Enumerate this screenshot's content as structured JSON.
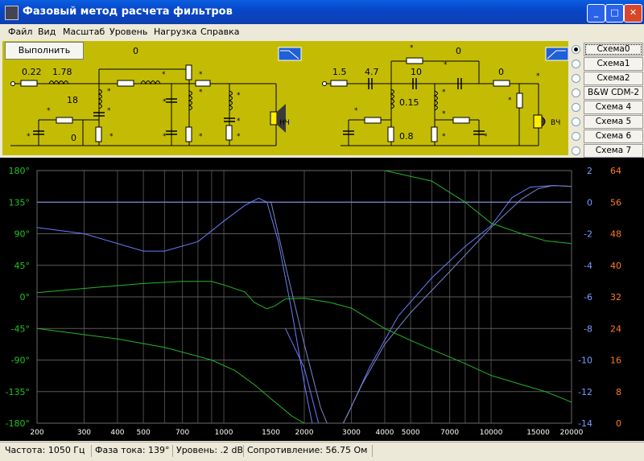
{
  "window": {
    "title": "Фазовый метод расчета фильтров"
  },
  "menu": [
    "Файл",
    "Вид",
    "Масштаб",
    "Уровень",
    "Нагрузка",
    "Справка"
  ],
  "run_label": "Выполнить",
  "schemes": {
    "items": [
      "Схема0",
      "Схема1",
      "Схема2",
      "B&W CDM-2",
      "Схема 4",
      "Схема 5",
      "Схема 6",
      "Схема 7"
    ],
    "selected": 0
  },
  "circuit": {
    "lf": {
      "r1": "0.22",
      "l1": "1.78",
      "c1": "18",
      "r2": "0",
      "l2": "0",
      "speaker": "НЧ",
      "star": "*"
    },
    "hf": {
      "r1": "1.5",
      "c1": "4.7",
      "c2": "10",
      "c3": "0",
      "l1": "0.15",
      "l2": "0.8",
      "r2": "0",
      "speaker": "ВЧ",
      "star": "*"
    }
  },
  "chart_data": {
    "type": "line",
    "x_ticks": [
      "200",
      "300",
      "400",
      "500",
      "700",
      "1000",
      "1500",
      "2000",
      "3000",
      "4000",
      "5000",
      "7000",
      "10000",
      "15000",
      "20000"
    ],
    "xlim": [
      200,
      20000
    ],
    "xscale": "log",
    "y_phase": {
      "ticks": [
        "180°",
        "135°",
        "90°",
        "45°",
        "0°",
        "-45°",
        "-90°",
        "-135°",
        "-180°"
      ],
      "range": [
        -180,
        180
      ]
    },
    "y_db": {
      "ticks": [
        "2",
        "0",
        "-2",
        "-4",
        "-6",
        "-8",
        "-10",
        "-12",
        "-14"
      ],
      "range": [
        -14,
        2
      ]
    },
    "y_ohm": {
      "ticks": [
        "64",
        "56",
        "48",
        "40",
        "32",
        "24",
        "16",
        "8",
        "0"
      ],
      "range": [
        0,
        64
      ]
    },
    "series": [
      {
        "color": "#6a7cff",
        "points": [
          [
            200,
            -1.6
          ],
          [
            300,
            -2.0
          ],
          [
            500,
            -3.1
          ],
          [
            600,
            -3.1
          ],
          [
            800,
            -2.5
          ],
          [
            1000,
            -1.2
          ],
          [
            1200,
            -0.2
          ],
          [
            1350,
            0.25
          ],
          [
            1450,
            0.0
          ],
          [
            1600,
            -2.5
          ],
          [
            1800,
            -7.0
          ],
          [
            2000,
            -11.5
          ],
          [
            2200,
            -15
          ]
        ]
      },
      {
        "color": "#6a7cff",
        "points": [
          [
            1700,
            -8
          ],
          [
            2000,
            -10.5
          ],
          [
            2300,
            -14.5
          ],
          [
            2600,
            -15
          ],
          [
            2900,
            -13.5
          ],
          [
            3500,
            -10.5
          ],
          [
            4500,
            -7.2
          ],
          [
            6000,
            -4.8
          ],
          [
            8000,
            -2.8
          ],
          [
            10000,
            -1.5
          ],
          [
            12000,
            0.3
          ],
          [
            14000,
            0.95
          ],
          [
            17000,
            1.05
          ],
          [
            20000,
            1.0
          ]
        ]
      },
      {
        "color": "#7a86c8",
        "points": [
          [
            1500,
            0.05
          ],
          [
            1700,
            -4
          ],
          [
            2000,
            -9
          ],
          [
            2300,
            -13
          ],
          [
            2500,
            -14.5
          ],
          [
            2800,
            -14
          ],
          [
            3300,
            -11.5
          ],
          [
            4000,
            -9
          ],
          [
            5000,
            -7
          ],
          [
            7000,
            -4.4
          ],
          [
            10000,
            -1.6
          ],
          [
            13000,
            0.2
          ],
          [
            15000,
            0.85
          ],
          [
            17000,
            1.05
          ],
          [
            20000,
            1.0
          ]
        ]
      },
      {
        "color": "#8898ff",
        "points": [
          [
            200,
            0
          ],
          [
            20000,
            0
          ]
        ]
      },
      {
        "color": "#28b428",
        "points": [
          [
            200,
            6
          ],
          [
            300,
            12
          ],
          [
            500,
            19
          ],
          [
            700,
            22
          ],
          [
            800,
            22
          ],
          [
            900,
            22
          ],
          [
            1000,
            17
          ],
          [
            1200,
            7
          ],
          [
            1300,
            -8
          ],
          [
            1450,
            -17
          ],
          [
            1550,
            -13
          ],
          [
            1700,
            -3
          ],
          [
            2000,
            -2
          ],
          [
            2500,
            -8
          ],
          [
            3000,
            -16
          ],
          [
            4000,
            -45
          ],
          [
            5000,
            -62
          ],
          [
            6000,
            -75
          ],
          [
            8000,
            -95
          ],
          [
            10000,
            -112
          ],
          [
            13000,
            -125
          ],
          [
            16000,
            -135
          ],
          [
            20000,
            -150
          ]
        ]
      },
      {
        "color": "#28b428",
        "points": [
          [
            200,
            -45
          ],
          [
            400,
            -60
          ],
          [
            600,
            -72
          ],
          [
            900,
            -90
          ],
          [
            1100,
            -105
          ],
          [
            1300,
            -125
          ],
          [
            1500,
            -145
          ],
          [
            1800,
            -170
          ],
          [
            2000,
            -180
          ]
        ]
      },
      {
        "color": "#28b428",
        "points": [
          [
            4000,
            180
          ],
          [
            6000,
            165
          ],
          [
            8000,
            135
          ],
          [
            10000,
            105
          ],
          [
            13000,
            90
          ],
          [
            16000,
            80
          ],
          [
            20000,
            76
          ]
        ]
      }
    ]
  },
  "status": {
    "freq": "Частота: 1050 Гц",
    "phase": "Фаза тока:  139°",
    "level": "Уровень:   .2 dB",
    "impedance": "Сопротивление:  56.75 Ом"
  }
}
